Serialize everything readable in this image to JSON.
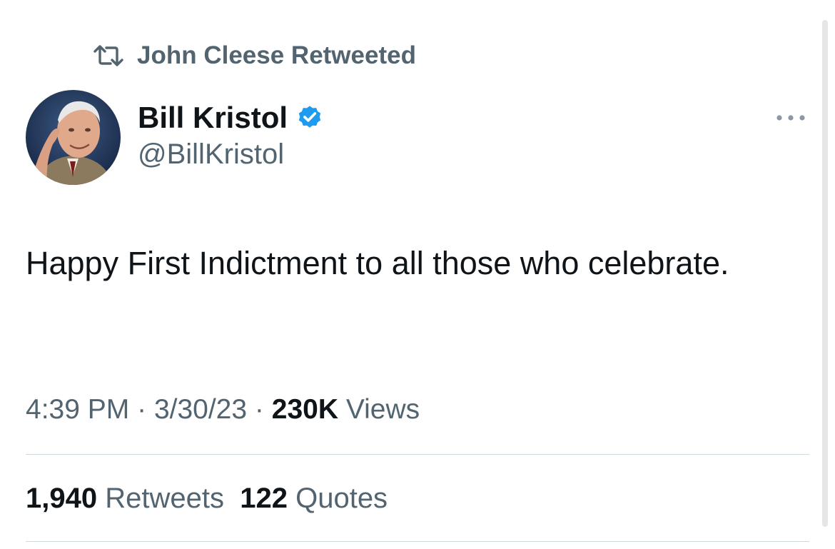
{
  "retweet": {
    "icon": "retweet-icon",
    "text": "John Cleese Retweeted",
    "color": "#536471"
  },
  "author": {
    "name": "Bill Kristol",
    "handle": "@BillKristol",
    "verified": true,
    "verified_color": "#1d9bf0",
    "avatar_icon": "profile-photo"
  },
  "tweet": {
    "text": "Happy First Indictment to all those who celebrate."
  },
  "meta": {
    "time": "4:39 PM",
    "separator": "·",
    "date": "3/30/23",
    "views_count": "230K",
    "views_label": "Views"
  },
  "stats": {
    "retweets_count": "1,940",
    "retweets_label": "Retweets",
    "quotes_count": "122",
    "quotes_label": "Quotes"
  },
  "more_icon": "more-horizontal-icon"
}
